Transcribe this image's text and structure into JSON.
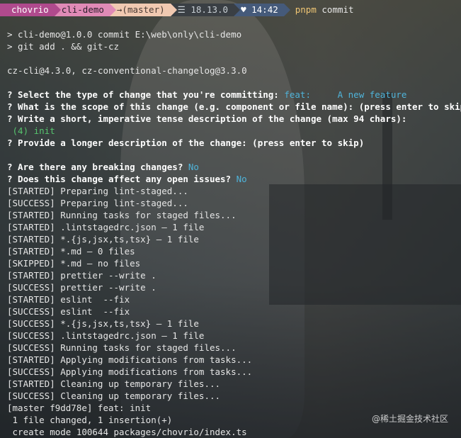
{
  "status_bar": {
    "user": "chovrio",
    "dir": "cli-demo",
    "git": "→(master)",
    "node": "☰ 18.13.0",
    "time": "♥ 14:42",
    "command_tool": "pnpm",
    "command_arg": "commit"
  },
  "lines": {
    "l1": "> cli-demo@1.0.0 commit E:\\web\\only\\cli-demo",
    "l2": "> git add . && git-cz",
    "l3": "cz-cli@4.3.0, cz-conventional-changelog@3.3.0",
    "q_type": "? Select the type of change that you're committing:",
    "q_type_ans": "feat:     A new feature",
    "q_scope": "? What is the scope of this change (e.g. component or file name): (press enter to skip)",
    "q_desc": "? Write a short, imperative tense description of the change (max 94 chars):",
    "q_desc_ans": " (4) init",
    "q_long": "? Provide a longer description of the change: (press enter to skip)",
    "q_break": "? Are there any breaking changes?",
    "q_break_ans": "No",
    "q_issues": "? Does this change affect any open issues?",
    "q_issues_ans": "No",
    "o1": "[STARTED] Preparing lint-staged...",
    "o2": "[SUCCESS] Preparing lint-staged...",
    "o3": "[STARTED] Running tasks for staged files...",
    "o4": "[STARTED] .lintstagedrc.json — 1 file",
    "o5": "[STARTED] *.{js,jsx,ts,tsx} — 1 file",
    "o6": "[STARTED] *.md — 0 files",
    "o7": "[SKIPPED] *.md — no files",
    "o8": "[STARTED] prettier --write .",
    "o9": "[SUCCESS] prettier --write .",
    "o10": "[STARTED] eslint  --fix",
    "o11": "[SUCCESS] eslint  --fix",
    "o12": "[SUCCESS] *.{js,jsx,ts,tsx} — 1 file",
    "o13": "[SUCCESS] .lintstagedrc.json — 1 file",
    "o14": "[SUCCESS] Running tasks for staged files...",
    "o15": "[STARTED] Applying modifications from tasks...",
    "o16": "[SUCCESS] Applying modifications from tasks...",
    "o17": "[STARTED] Cleaning up temporary files...",
    "o18": "[SUCCESS] Cleaning up temporary files...",
    "o19": "[master f9dd78e] feat: init",
    "o20": " 1 file changed, 1 insertion(+)",
    "o21": " create mode 100644 packages/chovrio/index.ts"
  },
  "watermark": "@稀土掘金技术社区",
  "colors": {
    "prompt": "#4bb3a8",
    "answer": "#4fb3d9",
    "input_green": "#56c46e",
    "user_segment": "#b04a8d",
    "dir_segment": "#e08ab6",
    "git_segment": "#f1c9b1",
    "time_segment": "#455a7a"
  }
}
